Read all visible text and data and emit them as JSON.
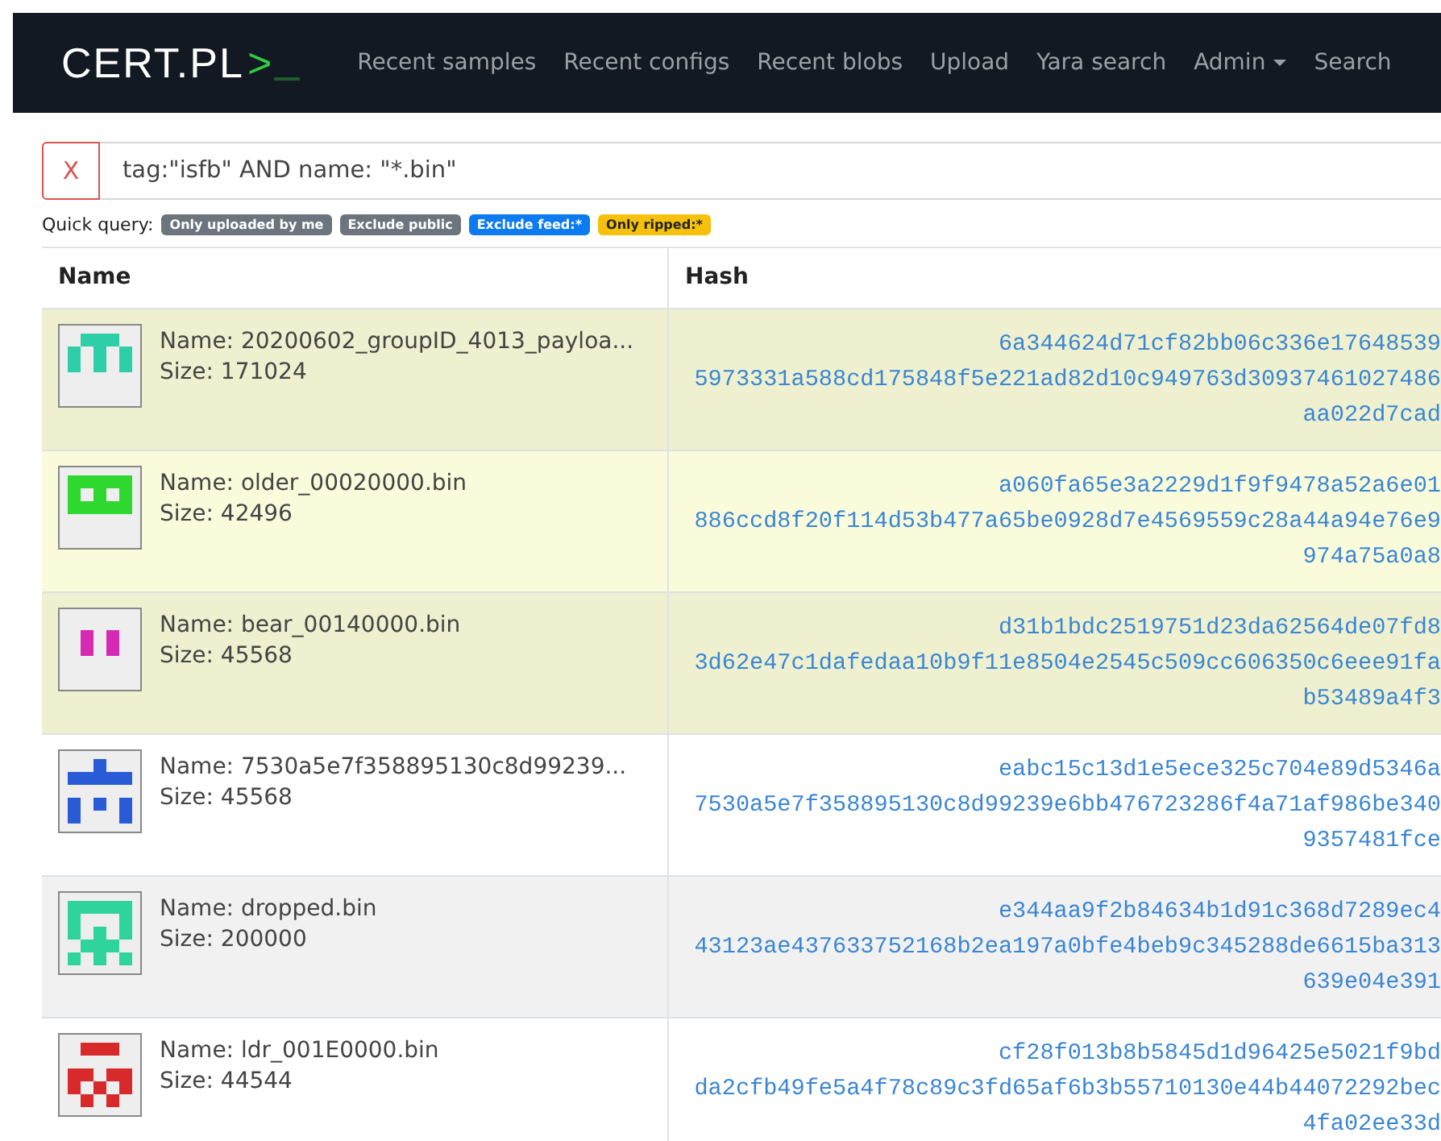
{
  "navbar": {
    "logo": {
      "text": "CERT.PL",
      "mark": ">"
    },
    "links": [
      {
        "label": "Recent samples",
        "dropdown": false
      },
      {
        "label": "Recent configs",
        "dropdown": false
      },
      {
        "label": "Recent blobs",
        "dropdown": false
      },
      {
        "label": "Upload",
        "dropdown": false
      },
      {
        "label": "Yara search",
        "dropdown": false
      },
      {
        "label": "Admin",
        "dropdown": true
      },
      {
        "label": "Search",
        "dropdown": false
      }
    ]
  },
  "search": {
    "clear_label": "X",
    "value": "tag:\"isfb\" AND name: \"*.bin\""
  },
  "quick_query": {
    "label": "Quick query:",
    "badges": [
      {
        "label": "Only uploaded by me",
        "color": "#6c757d"
      },
      {
        "label": "Exclude public",
        "color": "#6c757d"
      },
      {
        "label": "Exclude feed:*",
        "color": "#0d7bf0"
      },
      {
        "label": "Only ripped:*",
        "color": "#f5c10c"
      }
    ]
  },
  "table": {
    "columns": [
      "Name",
      "Hash"
    ],
    "rows": [
      {
        "kind": "olive",
        "color": "#2ecfa8",
        "name": "Name: 20200602_groupID_4013_payloa...",
        "size": "Size: 171024",
        "hash": [
          "6a344624d71cf82bb06c336e17648539",
          "5973331a588cd175848f5e221ad82d10c949763d30937461027486",
          "aa022d7cad"
        ]
      },
      {
        "kind": "yellow",
        "color": "#2ed82e",
        "name": "Name: older_00020000.bin",
        "size": "Size: 42496",
        "hash": [
          "a060fa65e3a2229d1f9f9478a52a6e01",
          "886ccd8f20f114d53b477a65be0928d7e4569559c28a44a94e76e9",
          "974a75a0a8"
        ]
      },
      {
        "kind": "olive",
        "color": "#d62ab4",
        "name": "Name: bear_00140000.bin",
        "size": "Size: 45568",
        "hash": [
          "d31b1bdc2519751d23da62564de07fd8",
          "3d62e47c1dafedaa10b9f11e8504e2545c509cc606350c6eee91fa",
          "b53489a4f3"
        ]
      },
      {
        "kind": "plain",
        "color": "#2a5bd6",
        "name": "Name: 7530a5e7f358895130c8d99239...",
        "size": "Size: 45568",
        "hash": [
          "eabc15c13d1e5ece325c704e89d5346a",
          "7530a5e7f358895130c8d99239e6bb476723286f4a71af986be340",
          "9357481fce"
        ]
      },
      {
        "kind": "grey",
        "color": "#2ed49c",
        "name": "Name: dropped.bin",
        "size": "Size: 200000",
        "hash": [
          "e344aa9f2b84634b1d91c368d7289ec4",
          "43123ae437633752168b2ea197a0bfe4beb9c345288de6615ba313",
          "639e04e391"
        ]
      },
      {
        "kind": "plain",
        "color": "#d82a2a",
        "name": "Name: ldr_001E0000.bin",
        "size": "Size: 44544",
        "hash": [
          "cf28f013b8b5845d1d96425e5021f9bd",
          "da2cfb49fe5a4f78c89c3fd65af6b3b55710130e44b44072292bec",
          "4fa02ee33d"
        ]
      }
    ]
  }
}
